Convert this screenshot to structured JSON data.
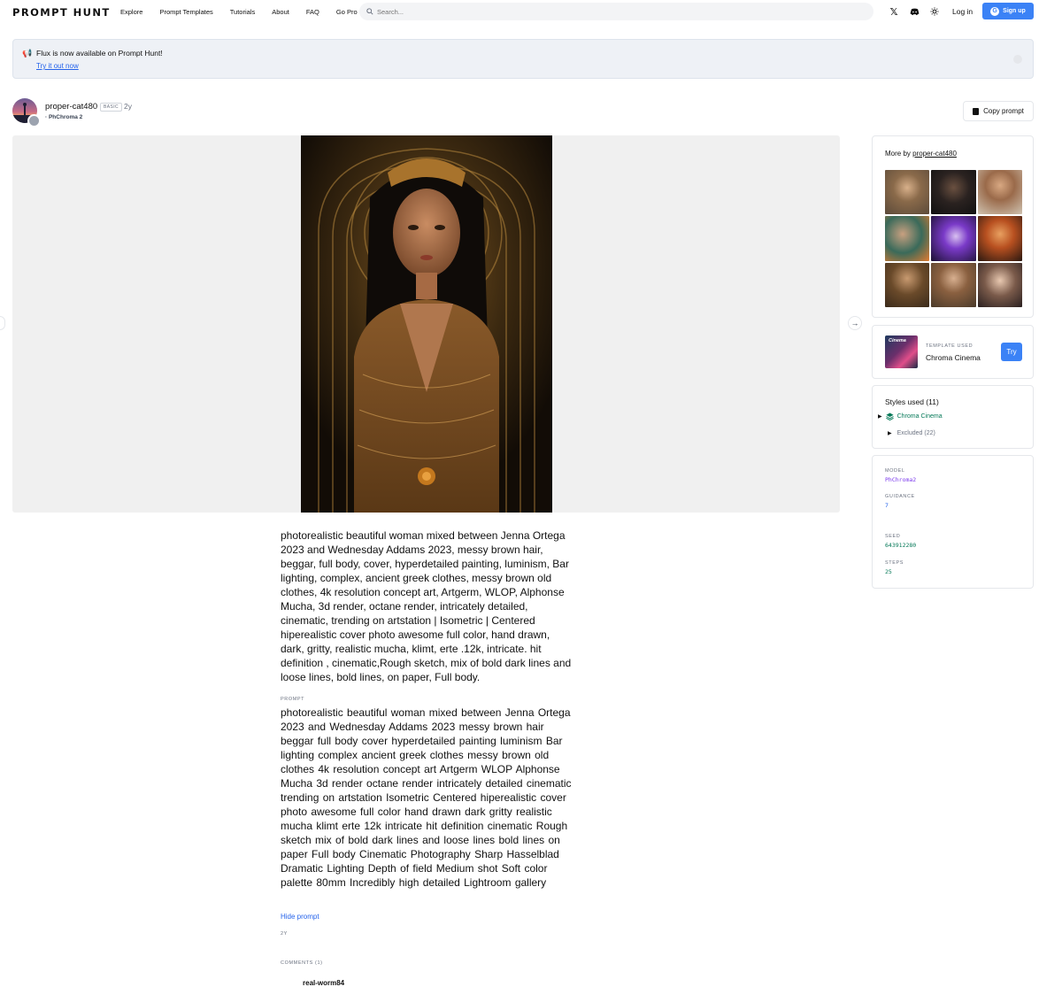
{
  "nav": {
    "logo": "PROMPT HUNT",
    "links": [
      "Explore",
      "Prompt Templates",
      "Tutorials",
      "About",
      "FAQ",
      "Go Pro"
    ],
    "search_placeholder": "Search...",
    "login": "Log in",
    "signup": "Sign up"
  },
  "banner": {
    "message": "Flux is now available on Prompt Hunt!",
    "link": "Try it out now"
  },
  "post": {
    "username": "proper-cat480",
    "badge": "BASIC",
    "age": "2y",
    "model": "· PhChroma 2",
    "copy_button": "Copy prompt",
    "description": "photorealistic beautiful woman mixed between Jenna Ortega 2023 and Wednesday Addams 2023, messy brown hair, beggar, full body, cover, hyperdetailed painting, luminism, Bar lighting, complex, ancient greek clothes, messy brown old clothes, 4k resolution concept art, Artgerm, WLOP, Alphonse Mucha, 3d render, octane render, intricately detailed, cinematic, trending on artstation | Isometric | Centered hiperealistic cover photo awesome full color, hand drawn, dark, gritty, realistic mucha, klimt, erte .12k, intricate. hit definition , cinematic,Rough sketch, mix of bold dark lines and loose lines, bold lines, on paper, Full body.",
    "prompt_label": "PROMPT",
    "prompt": "photorealistic beautiful woman mixed between Jenna Ortega 2023 and Wednesday Addams 2023  messy brown hair beggar full body cover hyperdetailed painting luminism Bar lighting complex ancient greek clothes messy brown old clothes 4k resolution concept art Artgerm WLOP Alphonse Mucha 3d render octane render intricately detailed cinematic trending on artstation Isometric Centered hiperealistic cover photo awesome full color hand drawn dark gritty realistic mucha klimt erte 12k intricate hit definition cinematic Rough sketch mix of bold dark lines and loose lines bold lines on paper Full body Cinematic Photography Sharp Hasselblad Dramatic Lighting Depth of field Medium shot Soft color palette 80mm Incredibly high detailed Lightroom gallery",
    "hide_prompt": "Hide prompt",
    "time_label": "2Y",
    "comments_label": "COMMENTS (1)",
    "commenter": "real-worm84"
  },
  "sidebar": {
    "more_by_prefix": "More by",
    "more_by_user": "proper-cat480",
    "template_label": "TEMPLATE USED",
    "template_name": "Chroma Cinema",
    "template_thumb_text": "Cinema",
    "try_button": "Try",
    "styles_title": "Styles used (11)",
    "style_item": "Chroma Cinema",
    "excluded": "Excluded (22)",
    "meta": [
      {
        "key": "MODEL",
        "value": "PhChroma2",
        "color": "#7c3aed"
      },
      {
        "key": "GUIDANCE",
        "value": "7",
        "color": "#2563eb"
      },
      {
        "key": "SEED",
        "value": "643912280",
        "color": "#047857"
      },
      {
        "key": "STEPS",
        "value": "25",
        "color": "#047857"
      }
    ]
  },
  "colors": {
    "accent": "#3b82f6",
    "link": "#2563eb",
    "banner_bg": "#eef1f6"
  }
}
